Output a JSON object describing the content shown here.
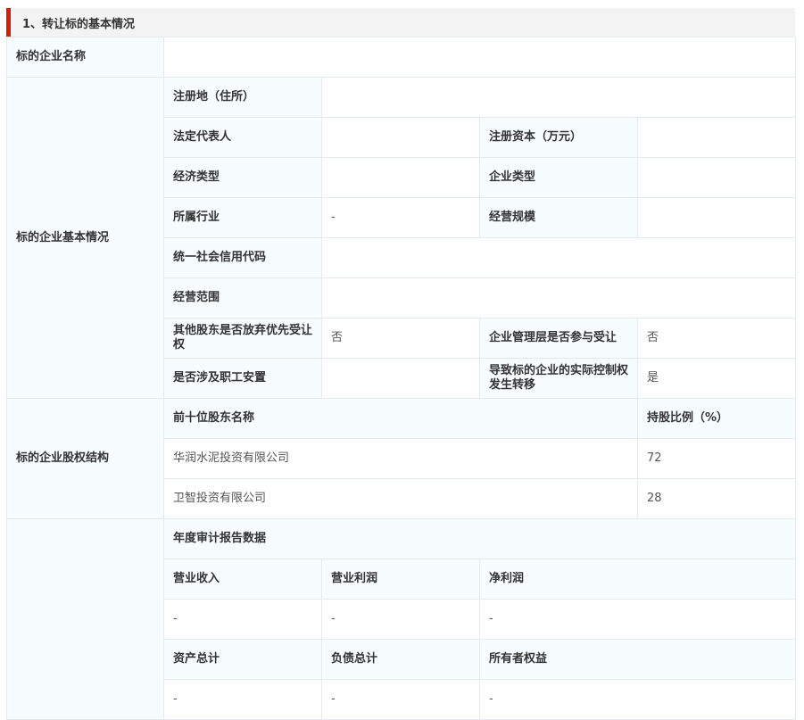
{
  "section_title": "1、转让标的基本情况",
  "company_name": {
    "label": "标的企业名称",
    "value": ""
  },
  "basic": {
    "label": "标的企业基本情况",
    "registered_address": {
      "label": "注册地（住所）",
      "value": ""
    },
    "legal_rep": {
      "label": "法定代表人",
      "value": ""
    },
    "registered_capital": {
      "label": "注册资本（万元）",
      "value": ""
    },
    "economic_type": {
      "label": "经济类型",
      "value": ""
    },
    "enterprise_type": {
      "label": "企业类型",
      "value": ""
    },
    "industry": {
      "label": "所属行业",
      "value": "-"
    },
    "scale": {
      "label": "经营规模",
      "value": ""
    },
    "credit_code": {
      "label": "统一社会信用代码",
      "value": ""
    },
    "scope": {
      "label": "经营范围",
      "value": ""
    },
    "waive_preemption": {
      "label": "其他股东是否放弃优先受让权",
      "value": "否"
    },
    "mgmt_participation": {
      "label": "企业管理层是否参与受让",
      "value": "否"
    },
    "staff_placement": {
      "label": "是否涉及职工安置",
      "value": ""
    },
    "control_transfer": {
      "label": "导致标的企业的实际控制权发生转移",
      "value": "是"
    }
  },
  "equity": {
    "label": "标的企业股权结构",
    "col_name": "前十位股东名称",
    "col_ratio": "持股比例（%）",
    "rows": [
      {
        "name": "华润水泥投资有限公司",
        "ratio": "72"
      },
      {
        "name": "卫智投资有限公司",
        "ratio": "28"
      }
    ]
  },
  "audit": {
    "title": "年度审计报告数据",
    "revenue": {
      "label": "营业收入",
      "value": "-"
    },
    "op_profit": {
      "label": "营业利润",
      "value": "-"
    },
    "net_profit": {
      "label": "净利润",
      "value": "-"
    },
    "total_assets": {
      "label": "资产总计",
      "value": "-"
    },
    "total_liabilities": {
      "label": "负债总计",
      "value": "-"
    },
    "owner_equity": {
      "label": "所有者权益",
      "value": "-"
    }
  }
}
